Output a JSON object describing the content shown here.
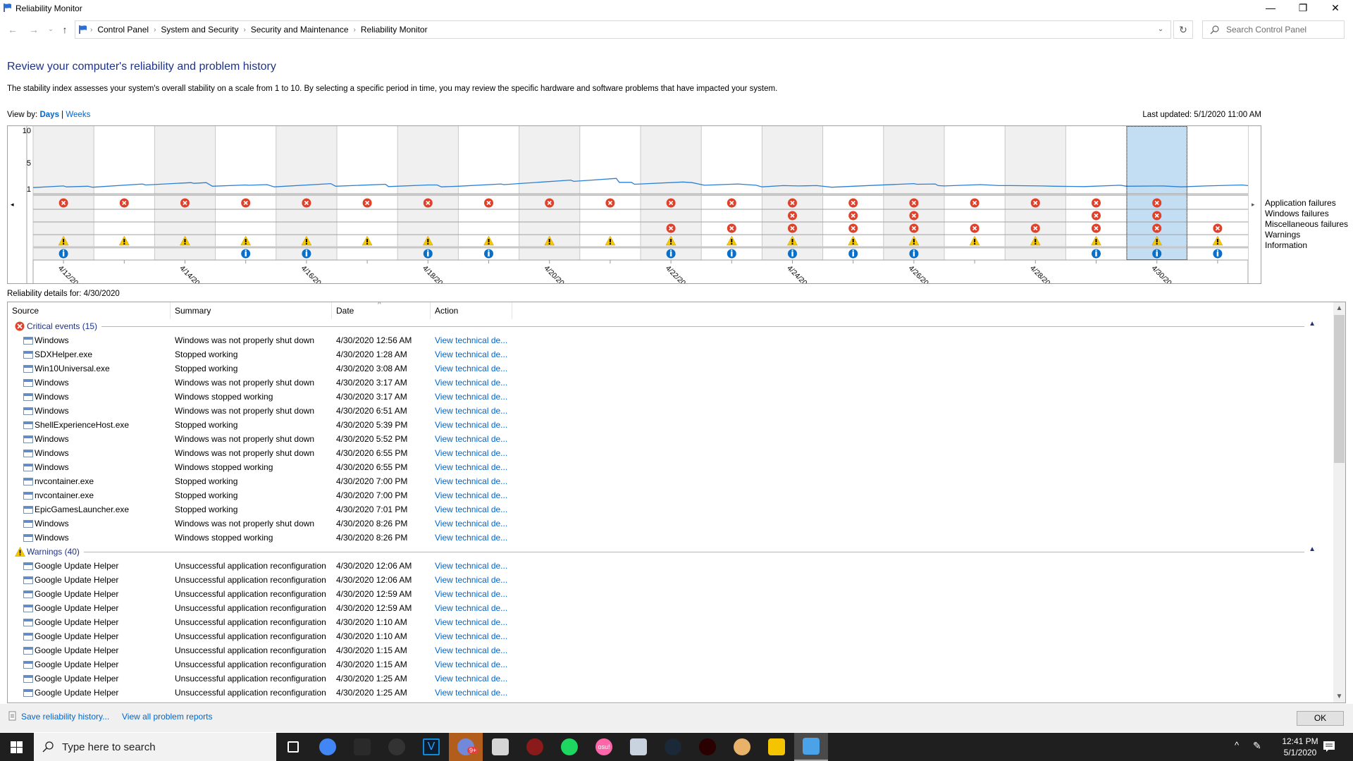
{
  "window": {
    "title": "Reliability Monitor",
    "controls": {
      "minimize": "—",
      "maximize": "❐",
      "close": "✕"
    }
  },
  "nav": {
    "back": "←",
    "forward": "→",
    "recent": "⌄",
    "up": "↑",
    "breadcrumb": [
      "Control Panel",
      "System and Security",
      "Security and Maintenance",
      "Reliability Monitor"
    ],
    "refresh": "↻",
    "search_placeholder": "Search Control Panel"
  },
  "header": {
    "title": "Review your computer's reliability and problem history",
    "description": "The stability index assesses your system's overall stability on a scale from 1 to 10. By selecting a specific period in time, you may review the specific hardware and software problems that have impacted your system.",
    "view_by_label": "View by:",
    "view_days": "Days",
    "view_weeks": "Weeks",
    "view_separator": "|",
    "last_updated": "Last updated: 5/1/2020 11:00 AM"
  },
  "chart_data": {
    "type": "line",
    "title": "Stability index",
    "ylim": [
      1,
      10
    ],
    "yticks": [
      "10",
      "5",
      "1"
    ],
    "x": [
      "4/12/2020",
      "4/13/2020",
      "4/14/2020",
      "4/15/2020",
      "4/16/2020",
      "4/17/2020",
      "4/18/2020",
      "4/19/2020",
      "4/20/2020",
      "4/21/2020",
      "4/22/2020",
      "4/23/2020",
      "4/24/2020",
      "4/25/2020",
      "4/26/2020",
      "4/27/2020",
      "4/28/2020",
      "4/29/2020",
      "4/30/2020",
      "5/1/2020"
    ],
    "xtick_labels": [
      "4/12/2020",
      "4/14/2020",
      "4/16/2020",
      "4/18/2020",
      "4/20/2020",
      "4/22/2020",
      "4/24/2020",
      "4/26/2020",
      "4/28/2020",
      "4/30/2020"
    ],
    "series": [
      {
        "name": "Stability index",
        "color": "#2b7fd4",
        "points": [
          [
            0.0,
            1.2
          ],
          [
            0.5,
            1.45
          ],
          [
            0.55,
            1.3
          ],
          [
            0.9,
            1.4
          ],
          [
            0.98,
            1.25
          ],
          [
            1.8,
            1.75
          ],
          [
            1.85,
            1.6
          ],
          [
            2.6,
            1.95
          ],
          [
            2.65,
            1.85
          ],
          [
            2.85,
            1.95
          ],
          [
            2.95,
            1.4
          ],
          [
            3.5,
            1.6
          ],
          [
            3.55,
            1.55
          ],
          [
            3.85,
            1.65
          ],
          [
            3.97,
            1.3
          ],
          [
            4.9,
            1.8
          ],
          [
            4.98,
            1.4
          ],
          [
            5.8,
            1.7
          ],
          [
            5.85,
            1.35
          ],
          [
            6.5,
            1.6
          ],
          [
            6.65,
            1.6
          ],
          [
            6.72,
            1.3
          ],
          [
            7.0,
            1.4
          ],
          [
            7.7,
            1.75
          ],
          [
            7.75,
            1.65
          ],
          [
            8.85,
            2.35
          ],
          [
            8.9,
            2.15
          ],
          [
            9.6,
            2.6
          ],
          [
            9.65,
            2.0
          ],
          [
            9.85,
            2.0
          ],
          [
            9.9,
            1.7
          ],
          [
            10.7,
            2.05
          ],
          [
            10.85,
            1.95
          ],
          [
            11.05,
            1.55
          ],
          [
            11.6,
            1.75
          ],
          [
            11.9,
            1.55
          ],
          [
            12.0,
            1.3
          ],
          [
            12.35,
            1.5
          ],
          [
            12.6,
            1.45
          ],
          [
            12.9,
            1.5
          ],
          [
            13.15,
            1.25
          ],
          [
            13.5,
            1.4
          ],
          [
            14.5,
            1.8
          ],
          [
            14.55,
            1.7
          ],
          [
            14.85,
            1.75
          ],
          [
            14.9,
            1.5
          ],
          [
            15.0,
            1.45
          ],
          [
            15.6,
            1.65
          ],
          [
            15.9,
            1.5
          ],
          [
            16.1,
            1.5
          ],
          [
            16.6,
            1.45
          ],
          [
            16.8,
            1.4
          ],
          [
            17.3,
            1.35
          ],
          [
            17.9,
            1.55
          ],
          [
            18.0,
            1.4
          ],
          [
            18.6,
            1.45
          ],
          [
            18.9,
            1.3
          ],
          [
            19.3,
            1.45
          ],
          [
            19.9,
            1.6
          ],
          [
            20.0,
            1.5
          ]
        ]
      }
    ],
    "event_rows": [
      "Application failures",
      "Windows failures",
      "Miscellaneous failures",
      "Warnings",
      "Information"
    ],
    "events": [
      {
        "date": "4/12/2020",
        "app": true,
        "win": false,
        "misc": false,
        "warn": true,
        "info": true
      },
      {
        "date": "4/13/2020",
        "app": true,
        "win": false,
        "misc": false,
        "warn": true,
        "info": false
      },
      {
        "date": "4/14/2020",
        "app": true,
        "win": false,
        "misc": false,
        "warn": true,
        "info": false
      },
      {
        "date": "4/15/2020",
        "app": true,
        "win": false,
        "misc": false,
        "warn": true,
        "info": true
      },
      {
        "date": "4/16/2020",
        "app": true,
        "win": false,
        "misc": false,
        "warn": true,
        "info": true
      },
      {
        "date": "4/17/2020",
        "app": true,
        "win": false,
        "misc": false,
        "warn": true,
        "info": false
      },
      {
        "date": "4/18/2020",
        "app": true,
        "win": false,
        "misc": false,
        "warn": true,
        "info": true
      },
      {
        "date": "4/19/2020",
        "app": true,
        "win": false,
        "misc": false,
        "warn": true,
        "info": true
      },
      {
        "date": "4/20/2020",
        "app": true,
        "win": false,
        "misc": false,
        "warn": true,
        "info": false
      },
      {
        "date": "4/21/2020",
        "app": true,
        "win": false,
        "misc": false,
        "warn": true,
        "info": false
      },
      {
        "date": "4/22/2020",
        "app": true,
        "win": false,
        "misc": true,
        "warn": true,
        "info": true
      },
      {
        "date": "4/23/2020",
        "app": true,
        "win": false,
        "misc": true,
        "warn": true,
        "info": true
      },
      {
        "date": "4/24/2020",
        "app": true,
        "win": true,
        "misc": true,
        "warn": true,
        "info": true
      },
      {
        "date": "4/25/2020",
        "app": true,
        "win": true,
        "misc": true,
        "warn": true,
        "info": true
      },
      {
        "date": "4/26/2020",
        "app": true,
        "win": true,
        "misc": true,
        "warn": true,
        "info": true
      },
      {
        "date": "4/27/2020",
        "app": true,
        "win": false,
        "misc": true,
        "warn": true,
        "info": false
      },
      {
        "date": "4/28/2020",
        "app": true,
        "win": false,
        "misc": true,
        "warn": true,
        "info": false
      },
      {
        "date": "4/29/2020",
        "app": true,
        "win": true,
        "misc": true,
        "warn": true,
        "info": true
      },
      {
        "date": "4/30/2020",
        "app": true,
        "win": true,
        "misc": true,
        "warn": true,
        "info": true
      },
      {
        "date": "5/1/2020",
        "app": false,
        "win": false,
        "misc": true,
        "warn": true,
        "info": true
      }
    ],
    "selected": "4/30/2020",
    "shaded_columns": [
      "4/12/2020",
      "4/14/2020",
      "4/16/2020",
      "4/18/2020",
      "4/20/2020",
      "4/22/2020",
      "4/24/2020",
      "4/26/2020",
      "4/28/2020"
    ],
    "grid": true,
    "legend": "right",
    "colors": {
      "line": "#2b7fd4",
      "selected": "#c3ddf3",
      "shade": "#f0f0f0",
      "error": "#e0412b",
      "warning": "#f6c800",
      "info": "#0a6fc9"
    },
    "scroll_left": "◂",
    "scroll_right": "▸"
  },
  "details": {
    "label": "Reliability details for: 4/30/2020",
    "columns": [
      "Source",
      "Summary",
      "Date",
      "Action"
    ],
    "sort_indicator": "^",
    "groups": [
      {
        "name": "Critical events (15)",
        "icon": "error-icon",
        "rows": [
          {
            "source": "Windows",
            "summary": "Windows was not properly shut down",
            "date": "4/30/2020 12:56 AM",
            "action": "View technical de..."
          },
          {
            "source": "SDXHelper.exe",
            "summary": "Stopped working",
            "date": "4/30/2020 1:28 AM",
            "action": "View technical de..."
          },
          {
            "source": "Win10Universal.exe",
            "summary": "Stopped working",
            "date": "4/30/2020 3:08 AM",
            "action": "View technical de..."
          },
          {
            "source": "Windows",
            "summary": "Windows was not properly shut down",
            "date": "4/30/2020 3:17 AM",
            "action": "View technical de..."
          },
          {
            "source": "Windows",
            "summary": "Windows stopped working",
            "date": "4/30/2020 3:17 AM",
            "action": "View technical de..."
          },
          {
            "source": "Windows",
            "summary": "Windows was not properly shut down",
            "date": "4/30/2020 6:51 AM",
            "action": "View technical de..."
          },
          {
            "source": "ShellExperienceHost.exe",
            "summary": "Stopped working",
            "date": "4/30/2020 5:39 PM",
            "action": "View technical de..."
          },
          {
            "source": "Windows",
            "summary": "Windows was not properly shut down",
            "date": "4/30/2020 5:52 PM",
            "action": "View technical de..."
          },
          {
            "source": "Windows",
            "summary": "Windows was not properly shut down",
            "date": "4/30/2020 6:55 PM",
            "action": "View technical de..."
          },
          {
            "source": "Windows",
            "summary": "Windows stopped working",
            "date": "4/30/2020 6:55 PM",
            "action": "View technical de..."
          },
          {
            "source": "nvcontainer.exe",
            "summary": "Stopped working",
            "date": "4/30/2020 7:00 PM",
            "action": "View technical de..."
          },
          {
            "source": "nvcontainer.exe",
            "summary": "Stopped working",
            "date": "4/30/2020 7:00 PM",
            "action": "View technical de..."
          },
          {
            "source": "EpicGamesLauncher.exe",
            "summary": "Stopped working",
            "date": "4/30/2020 7:01 PM",
            "action": "View technical de..."
          },
          {
            "source": "Windows",
            "summary": "Windows was not properly shut down",
            "date": "4/30/2020 8:26 PM",
            "action": "View technical de..."
          },
          {
            "source": "Windows",
            "summary": "Windows stopped working",
            "date": "4/30/2020 8:26 PM",
            "action": "View technical de..."
          }
        ]
      },
      {
        "name": "Warnings (40)",
        "icon": "warning-icon",
        "rows": [
          {
            "source": "Google Update Helper",
            "summary": "Unsuccessful application reconfiguration",
            "date": "4/30/2020 12:06 AM",
            "action": "View technical de..."
          },
          {
            "source": "Google Update Helper",
            "summary": "Unsuccessful application reconfiguration",
            "date": "4/30/2020 12:06 AM",
            "action": "View technical de..."
          },
          {
            "source": "Google Update Helper",
            "summary": "Unsuccessful application reconfiguration",
            "date": "4/30/2020 12:59 AM",
            "action": "View technical de..."
          },
          {
            "source": "Google Update Helper",
            "summary": "Unsuccessful application reconfiguration",
            "date": "4/30/2020 12:59 AM",
            "action": "View technical de..."
          },
          {
            "source": "Google Update Helper",
            "summary": "Unsuccessful application reconfiguration",
            "date": "4/30/2020 1:10 AM",
            "action": "View technical de..."
          },
          {
            "source": "Google Update Helper",
            "summary": "Unsuccessful application reconfiguration",
            "date": "4/30/2020 1:10 AM",
            "action": "View technical de..."
          },
          {
            "source": "Google Update Helper",
            "summary": "Unsuccessful application reconfiguration",
            "date": "4/30/2020 1:15 AM",
            "action": "View technical de..."
          },
          {
            "source": "Google Update Helper",
            "summary": "Unsuccessful application reconfiguration",
            "date": "4/30/2020 1:15 AM",
            "action": "View technical de..."
          },
          {
            "source": "Google Update Helper",
            "summary": "Unsuccessful application reconfiguration",
            "date": "4/30/2020 1:25 AM",
            "action": "View technical de..."
          },
          {
            "source": "Google Update Helper",
            "summary": "Unsuccessful application reconfiguration",
            "date": "4/30/2020 1:25 AM",
            "action": "View technical de..."
          }
        ]
      }
    ],
    "collapse_glyph": "^"
  },
  "footer": {
    "save_history": "Save reliability history...",
    "view_all_reports": "View all problem reports",
    "ok": "OK"
  },
  "taskbar": {
    "search_placeholder": "Type here to search",
    "apps": [
      {
        "name": "task-view",
        "color": "#1f1f1f"
      },
      {
        "name": "chrome",
        "color": "#4285f4"
      },
      {
        "name": "epic-games",
        "color": "#2a2a2a"
      },
      {
        "name": "mouse-app",
        "color": "#333333"
      },
      {
        "name": "vegas",
        "color": "#0d8bd8"
      },
      {
        "name": "discord",
        "color": "#7289da",
        "badge": "9+"
      },
      {
        "name": "roblox",
        "color": "#d6d6d6"
      },
      {
        "name": "target-app",
        "color": "#8b1a1a"
      },
      {
        "name": "spotify",
        "color": "#1ed760"
      },
      {
        "name": "osu",
        "color": "#ff66aa",
        "text": "osu!"
      },
      {
        "name": "app-blue-orb",
        "color": "#c9d3e0"
      },
      {
        "name": "steam",
        "color": "#1b2838"
      },
      {
        "name": "speed-app",
        "color": "#2b0000"
      },
      {
        "name": "landscape-app",
        "color": "#e8b26a"
      },
      {
        "name": "ld-player",
        "color": "#f5c400"
      },
      {
        "name": "reliability-monitor",
        "color": "#4aa3e8"
      }
    ],
    "time": "12:41 PM",
    "date": "5/1/2020",
    "tray_chevron": "^"
  }
}
